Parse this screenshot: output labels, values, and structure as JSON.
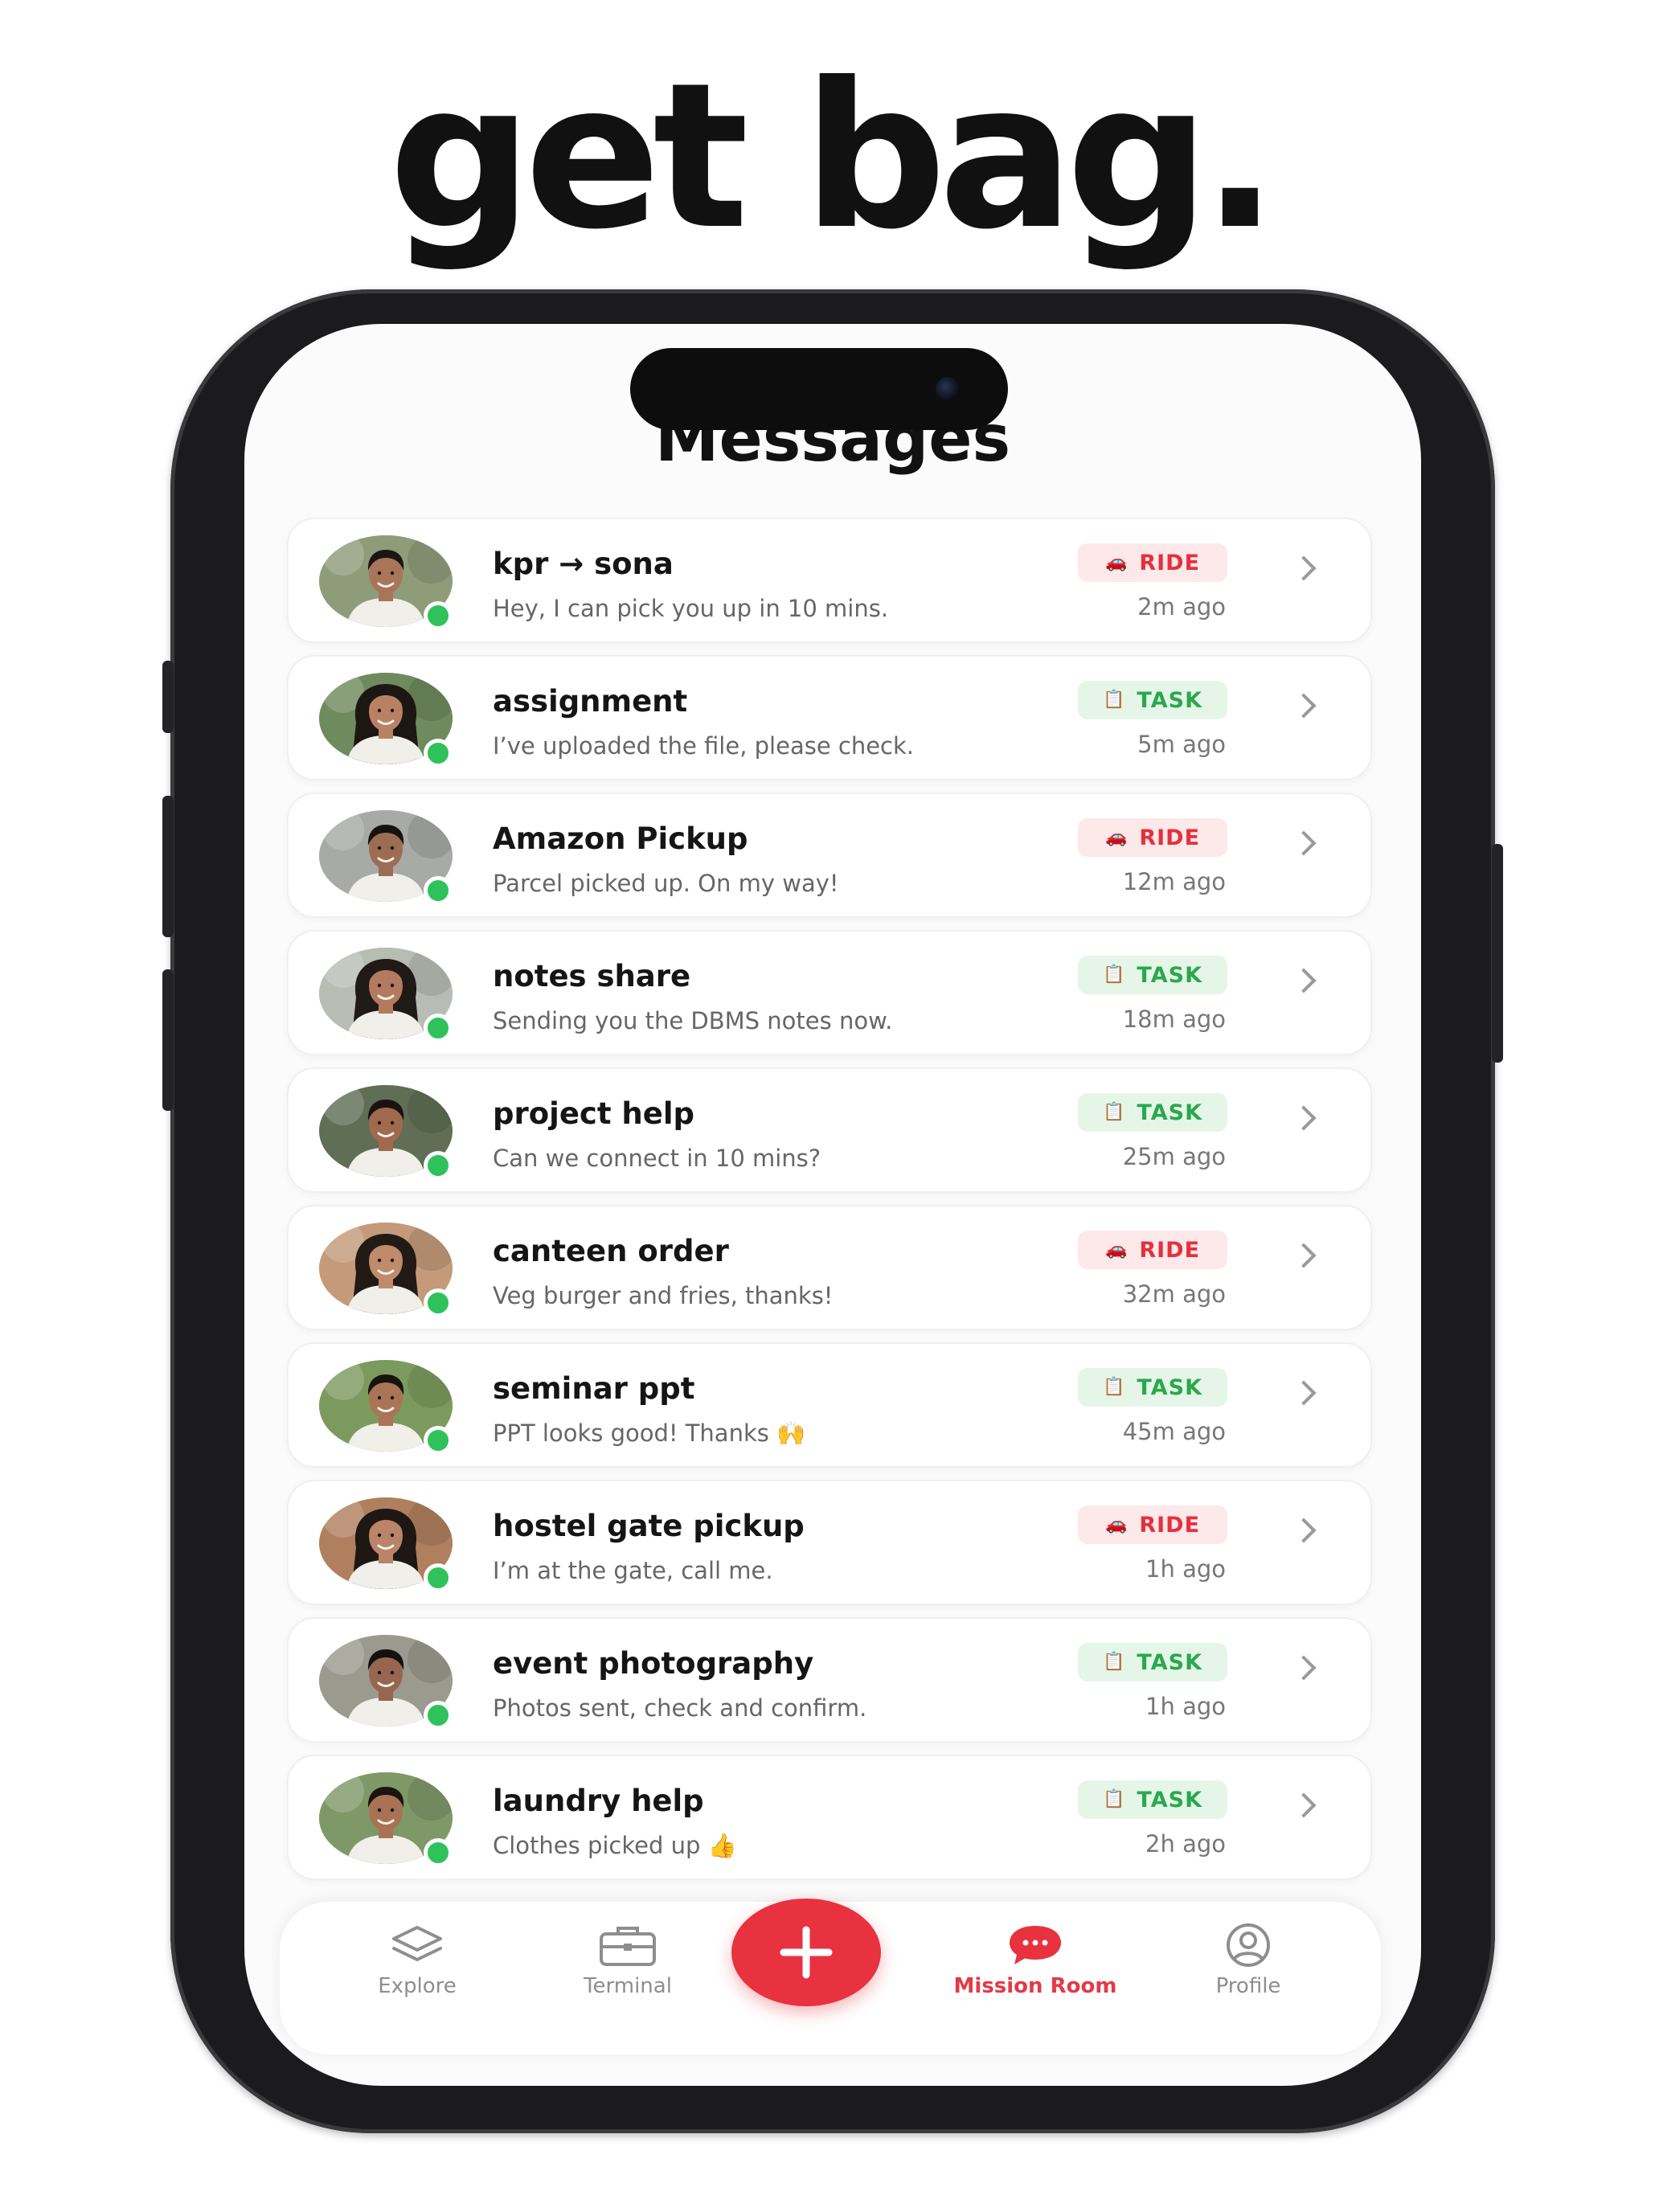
{
  "headline": "get bag.",
  "screen": {
    "title": "Messages"
  },
  "conversations": [
    {
      "name": "kpr → sona",
      "preview": "Hey, I can pick you up in 10 mins.",
      "badge": "RIDE",
      "badge_type": "ride",
      "time": "2m ago",
      "online": true
    },
    {
      "name": "assignment",
      "preview": "I’ve uploaded the file, please check.",
      "badge": "TASK",
      "badge_type": "task",
      "time": "5m ago",
      "online": true
    },
    {
      "name": "Amazon Pickup",
      "preview": "Parcel picked up. On my way!",
      "badge": "RIDE",
      "badge_type": "ride",
      "time": "12m ago",
      "online": true
    },
    {
      "name": "notes share",
      "preview": "Sending you the DBMS notes now.",
      "badge": "TASK",
      "badge_type": "task",
      "time": "18m ago",
      "online": true
    },
    {
      "name": "project help",
      "preview": "Can we connect in 10 mins?",
      "badge": "TASK",
      "badge_type": "task",
      "time": "25m ago",
      "online": true
    },
    {
      "name": "canteen order",
      "preview": "Veg burger and fries, thanks!",
      "badge": "RIDE",
      "badge_type": "ride",
      "time": "32m ago",
      "online": true
    },
    {
      "name": "seminar ppt",
      "preview": "PPT looks good! Thanks 🙌",
      "badge": "TASK",
      "badge_type": "task",
      "time": "45m ago",
      "online": true
    },
    {
      "name": "hostel gate pickup",
      "preview": "I’m at the gate, call me.",
      "badge": "RIDE",
      "badge_type": "ride",
      "time": "1h ago",
      "online": true
    },
    {
      "name": "event photography",
      "preview": "Photos sent, check and confirm.",
      "badge": "TASK",
      "badge_type": "task",
      "time": "1h ago",
      "online": true
    },
    {
      "name": "laundry help",
      "preview": "Clothes picked up 👍",
      "badge": "TASK",
      "badge_type": "task",
      "time": "2h ago",
      "online": true
    }
  ],
  "tabbar": {
    "explore": "Explore",
    "terminal": "Terminal",
    "mission_room": "Mission Room",
    "profile": "Profile",
    "active": "mission_room"
  },
  "colors": {
    "accent": "#e8323f",
    "ride_badge_bg": "#fde8ea",
    "ride_badge_text": "#e5303e",
    "task_badge_bg": "#e5f6e9",
    "task_badge_text": "#2aa84d",
    "online": "#2fc25b"
  },
  "icons": {
    "ride_badge": "car-icon",
    "task_badge": "clipboard-icon",
    "explore": "layers-icon",
    "terminal": "briefcase-icon",
    "fab": "plus-icon",
    "mission_room": "chat-bubble-icon",
    "profile": "user-circle-icon",
    "row": "chevron-right-icon"
  }
}
